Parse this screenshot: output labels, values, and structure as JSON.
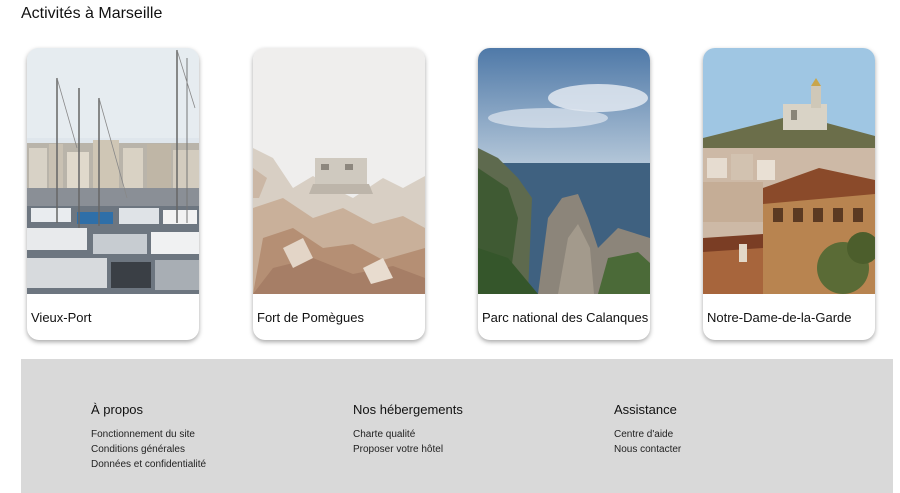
{
  "page": {
    "title": "Activités à Marseille"
  },
  "cards": [
    {
      "label": "Vieux-Port"
    },
    {
      "label": "Fort de Pomègues"
    },
    {
      "label": "Parc national des Calanques"
    },
    {
      "label": "Notre-Dame-de-la-Garde"
    }
  ],
  "footer": {
    "columns": [
      {
        "heading": "À propos",
        "links": [
          "Fonctionnement du site",
          "Conditions générales",
          "Données et confidentialité"
        ]
      },
      {
        "heading": "Nos hébergements",
        "links": [
          "Charte qualité",
          "Proposer votre hôtel"
        ]
      },
      {
        "heading": "Assistance",
        "links": [
          "Centre d'aide",
          "Nous contacter"
        ]
      }
    ]
  }
}
